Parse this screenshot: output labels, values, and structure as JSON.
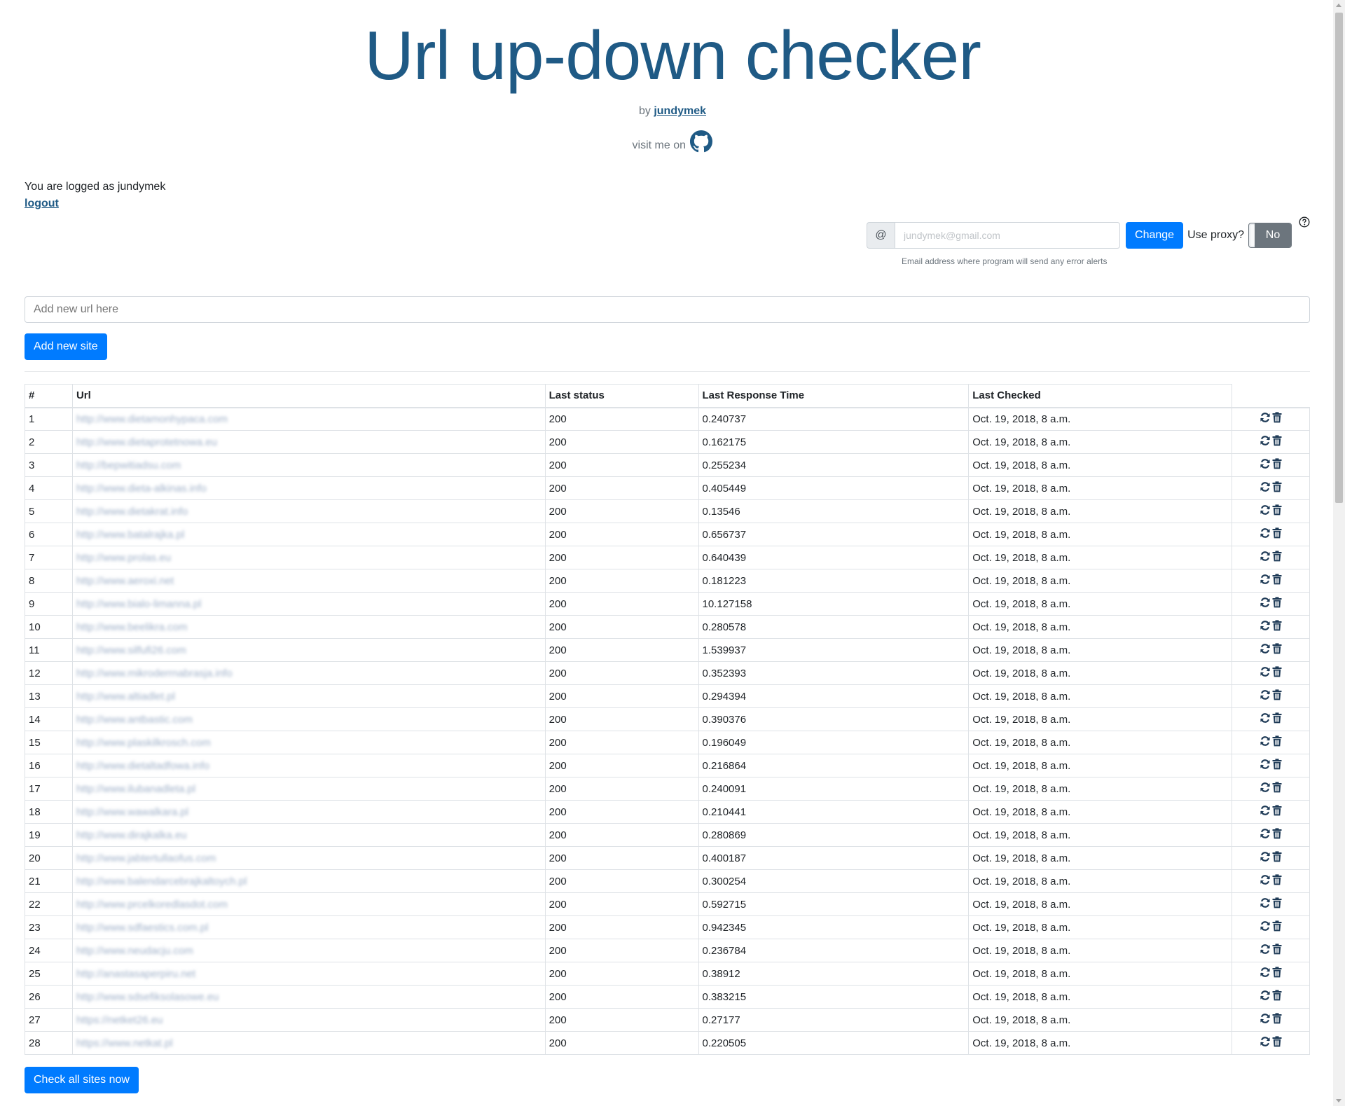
{
  "header": {
    "title": "Url up-down checker",
    "by_prefix": "by",
    "author": "jundymek",
    "visit_text": "visit me on"
  },
  "user": {
    "logged_text": "You are logged as jundymek",
    "logout_label": "logout"
  },
  "email": {
    "prefix": "@",
    "value": "jundymek@gmail.com",
    "change_label": "Change",
    "help_text": "Email address where program will send any error alerts"
  },
  "proxy": {
    "label": "Use proxy?",
    "state": "No"
  },
  "add_site": {
    "placeholder": "Add new url here",
    "button_label": "Add new site"
  },
  "table": {
    "headers": [
      "#",
      "Url",
      "Last status",
      "Last Response Time",
      "Last Checked"
    ],
    "rows": [
      {
        "n": "1",
        "url": "http://www.dietamonhypaca.com",
        "status": "200",
        "time": "0.240737",
        "checked": "Oct. 19, 2018, 8 a.m."
      },
      {
        "n": "2",
        "url": "http://www.dietaprotetnowa.eu",
        "status": "200",
        "time": "0.162175",
        "checked": "Oct. 19, 2018, 8 a.m."
      },
      {
        "n": "3",
        "url": "http://bepwitiadsu.com",
        "status": "200",
        "time": "0.255234",
        "checked": "Oct. 19, 2018, 8 a.m."
      },
      {
        "n": "4",
        "url": "http://www.dieta-alkinas.info",
        "status": "200",
        "time": "0.405449",
        "checked": "Oct. 19, 2018, 8 a.m."
      },
      {
        "n": "5",
        "url": "http://www.dietakrat.info",
        "status": "200",
        "time": "0.13546",
        "checked": "Oct. 19, 2018, 8 a.m."
      },
      {
        "n": "6",
        "url": "http://www.batalrajka.pl",
        "status": "200",
        "time": "0.656737",
        "checked": "Oct. 19, 2018, 8 a.m."
      },
      {
        "n": "7",
        "url": "http://www.prolas.eu",
        "status": "200",
        "time": "0.640439",
        "checked": "Oct. 19, 2018, 8 a.m."
      },
      {
        "n": "8",
        "url": "http://www.aeroxi.net",
        "status": "200",
        "time": "0.181223",
        "checked": "Oct. 19, 2018, 8 a.m."
      },
      {
        "n": "9",
        "url": "http://www.bialo-limanna.pl",
        "status": "200",
        "time": "10.127158",
        "checked": "Oct. 19, 2018, 8 a.m."
      },
      {
        "n": "10",
        "url": "http://www.beelikra.com",
        "status": "200",
        "time": "0.280578",
        "checked": "Oct. 19, 2018, 8 a.m."
      },
      {
        "n": "11",
        "url": "http://www.silfufi26.com",
        "status": "200",
        "time": "1.539937",
        "checked": "Oct. 19, 2018, 8 a.m."
      },
      {
        "n": "12",
        "url": "http://www.mikroderrnabrasja.info",
        "status": "200",
        "time": "0.352393",
        "checked": "Oct. 19, 2018, 8 a.m."
      },
      {
        "n": "13",
        "url": "http://www.altiadlet.pl",
        "status": "200",
        "time": "0.294394",
        "checked": "Oct. 19, 2018, 8 a.m."
      },
      {
        "n": "14",
        "url": "http://www.antbastic.com",
        "status": "200",
        "time": "0.390376",
        "checked": "Oct. 19, 2018, 8 a.m."
      },
      {
        "n": "15",
        "url": "http://www.plaskilkrosch.com",
        "status": "200",
        "time": "0.196049",
        "checked": "Oct. 19, 2018, 8 a.m."
      },
      {
        "n": "16",
        "url": "http://www.dietaltadfowa.info",
        "status": "200",
        "time": "0.216864",
        "checked": "Oct. 19, 2018, 8 a.m."
      },
      {
        "n": "17",
        "url": "http://www.ilubanadleta.pl",
        "status": "200",
        "time": "0.240091",
        "checked": "Oct. 19, 2018, 8 a.m."
      },
      {
        "n": "18",
        "url": "http://www.wawalkara.pl",
        "status": "200",
        "time": "0.210441",
        "checked": "Oct. 19, 2018, 8 a.m."
      },
      {
        "n": "19",
        "url": "http://www.dirajkalka.eu",
        "status": "200",
        "time": "0.280869",
        "checked": "Oct. 19, 2018, 8 a.m."
      },
      {
        "n": "20",
        "url": "http://www.jabtertullaofus.com",
        "status": "200",
        "time": "0.400187",
        "checked": "Oct. 19, 2018, 8 a.m."
      },
      {
        "n": "21",
        "url": "http://www.balendarcebrajkaltoych.pl",
        "status": "200",
        "time": "0.300254",
        "checked": "Oct. 19, 2018, 8 a.m."
      },
      {
        "n": "22",
        "url": "http://www.prcelkoredlasdot.com",
        "status": "200",
        "time": "0.592715",
        "checked": "Oct. 19, 2018, 8 a.m."
      },
      {
        "n": "23",
        "url": "http://www.sdfaestics.com.pl",
        "status": "200",
        "time": "0.942345",
        "checked": "Oct. 19, 2018, 8 a.m."
      },
      {
        "n": "24",
        "url": "http://www.neudacju.com",
        "status": "200",
        "time": "0.236784",
        "checked": "Oct. 19, 2018, 8 a.m."
      },
      {
        "n": "25",
        "url": "http://anastasaperpiru.net",
        "status": "200",
        "time": "0.38912",
        "checked": "Oct. 19, 2018, 8 a.m."
      },
      {
        "n": "26",
        "url": "http://www.sdsefiksolasowe.eu",
        "status": "200",
        "time": "0.383215",
        "checked": "Oct. 19, 2018, 8 a.m."
      },
      {
        "n": "27",
        "url": "https://netket26.eu",
        "status": "200",
        "time": "0.27177",
        "checked": "Oct. 19, 2018, 8 a.m."
      },
      {
        "n": "28",
        "url": "https://www.netkat.pl",
        "status": "200",
        "time": "0.220505",
        "checked": "Oct. 19, 2018, 8 a.m."
      }
    ]
  },
  "check_all_label": "Check all sites now",
  "icons": {
    "github": "github-icon",
    "help": "question-circle-icon",
    "refresh": "refresh-icon",
    "delete": "trash-icon"
  },
  "colors": {
    "title": "#1f5a85",
    "primary_button": "#007bff",
    "toggle_off": "#6c757d"
  }
}
